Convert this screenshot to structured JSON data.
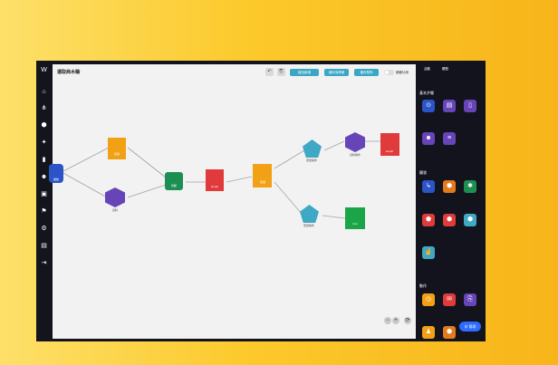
{
  "canvas": {
    "title": "運取商木稿"
  },
  "toolbar": {
    "buttons": [
      "增加新增",
      "儲存為草稿",
      "儲存發佈"
    ],
    "toggle_label": "顯著功用"
  },
  "sidebar": {
    "top_tabs": [
      "活動",
      "觸發"
    ],
    "section1": "基本步驟",
    "section2": "觸發",
    "section3": "動作",
    "fab_label": "⊕ 幫助"
  },
  "nodes": {
    "n1": "開始",
    "n2": "資料",
    "n3": "判斷",
    "n4": "Email",
    "n5": "延遲",
    "n6": "資料條件",
    "n7": "發送條件",
    "n8": "Email",
    "n9": "Line"
  }
}
